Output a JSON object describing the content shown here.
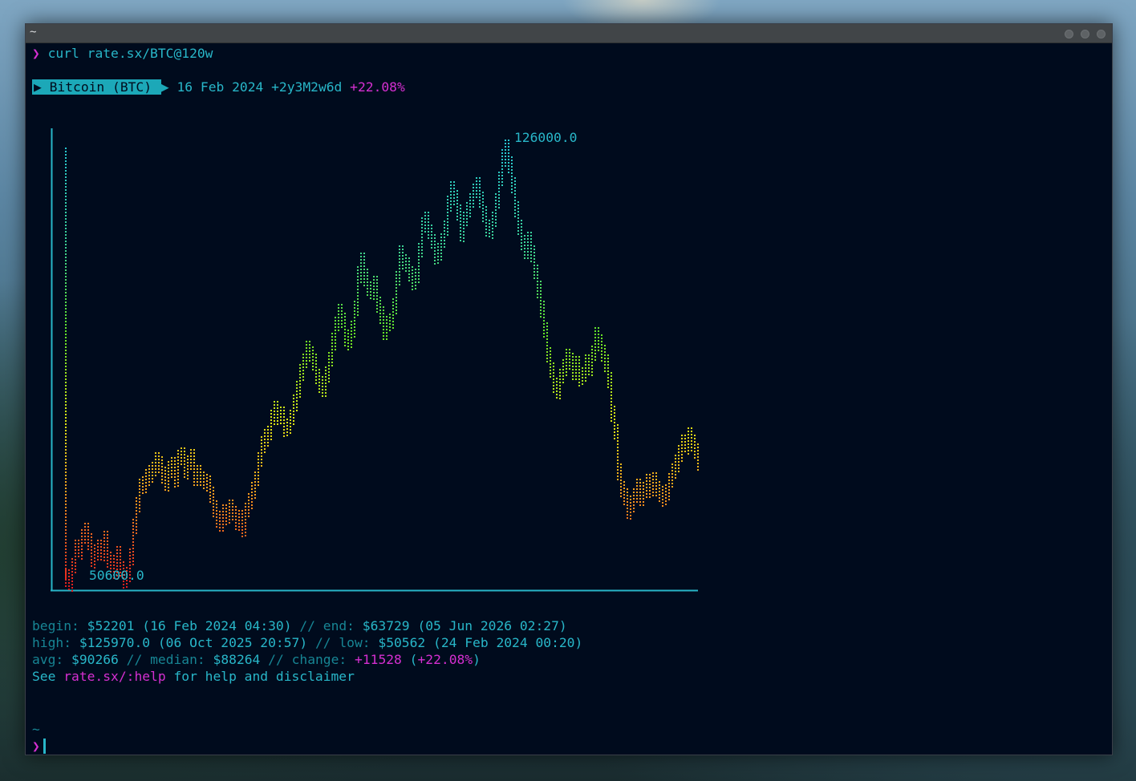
{
  "window": {
    "title": "~"
  },
  "command": {
    "prompt_symbol": "❯",
    "text": "curl rate.sx/BTC@120w"
  },
  "banner": {
    "asset": "Bitcoin (BTC)",
    "date": "16 Feb 2024",
    "duration": "+2y3M2w6d",
    "change_pct": "+22.08%"
  },
  "chart_data": {
    "type": "line",
    "ymax_label": "126000.0",
    "ymin_label": "50600.0",
    "ylim": [
      50600,
      126000
    ],
    "x_count": 120,
    "values": [
      52201,
      51400,
      54200,
      57300,
      56800,
      59100,
      60200,
      58400,
      55100,
      56500,
      57400,
      56300,
      58900,
      55300,
      54700,
      53400,
      56200,
      53600,
      51800,
      52600,
      55800,
      60900,
      64700,
      67800,
      68200,
      69400,
      70100,
      70700,
      72300,
      71600,
      69800,
      68200,
      70800,
      71500,
      69200,
      72700,
      73100,
      70400,
      71800,
      72900,
      69500,
      70200,
      69100,
      68600,
      68300,
      66400,
      64100,
      62300,
      61600,
      63400,
      62800,
      64200,
      63100,
      61800,
      62500,
      60800,
      63700,
      65300,
      67300,
      69100,
      72400,
      75100,
      76300,
      76900,
      79600,
      81200,
      79800,
      80200,
      77800,
      78100,
      79700,
      82300,
      84600,
      87500,
      89200,
      91400,
      90500,
      89200,
      86600,
      85400,
      84800,
      87100,
      89600,
      92800,
      95600,
      97800,
      96300,
      93400,
      92800,
      94900,
      98400,
      104200,
      106600,
      103800,
      101700,
      101200,
      102600,
      99100,
      97400,
      94300,
      95700,
      96200,
      98700,
      103500,
      107900,
      106300,
      105800,
      104300,
      102800,
      103900,
      108300,
      112700,
      113600,
      111400,
      109800,
      107500,
      108200,
      109900,
      112100,
      116300,
      118900,
      117400,
      114800,
      111200,
      113600,
      115200,
      116800,
      118400,
      119500,
      117100,
      114600,
      112300,
      111900,
      113600,
      116800,
      120500,
      124300,
      125970,
      123100,
      119600,
      115400,
      112200,
      109600,
      108400,
      110200,
      107900,
      104600,
      101800,
      98400,
      94600,
      90300,
      87700,
      85200,
      84100,
      86700,
      88300,
      90100,
      89400,
      87600,
      88800,
      86400,
      86900,
      89100,
      88200,
      90700,
      93800,
      92600,
      90800,
      89100,
      86100,
      80300,
      77200,
      70400,
      67400,
      66100,
      63700,
      64900,
      66200,
      67800,
      65900,
      67200,
      68600,
      67400,
      68900,
      67400,
      66500,
      65800,
      66900,
      68800,
      70400,
      71900,
      73600,
      75300,
      74800,
      76600,
      75400,
      73800,
      72100,
      70900,
      63729
    ]
  },
  "stats": {
    "begin_label": "begin:",
    "begin_value": "$52201",
    "begin_date": "(16 Feb 2024 04:30)",
    "sep": "//",
    "end_label": "end:",
    "end_value": "$63729",
    "end_date": "(05 Jun 2026 02:27)",
    "high_label": "high:",
    "high_value": "$125970.0",
    "high_date": "(06 Oct 2025 20:57)",
    "low_label": "low:",
    "low_value": "$50562",
    "low_date": "(24 Feb 2024 00:20)",
    "avg_label": "avg:",
    "avg_value": "$90266",
    "median_label": "median:",
    "median_value": "$88264",
    "change_label": "change:",
    "change_value": "+11528",
    "change_pct": "+22.08%",
    "help_prefix": "See ",
    "help_link": "rate.sx/:help",
    "help_suffix": " for help and disclaimer"
  },
  "prompt2": {
    "dir": "~",
    "symbol": "❯"
  }
}
